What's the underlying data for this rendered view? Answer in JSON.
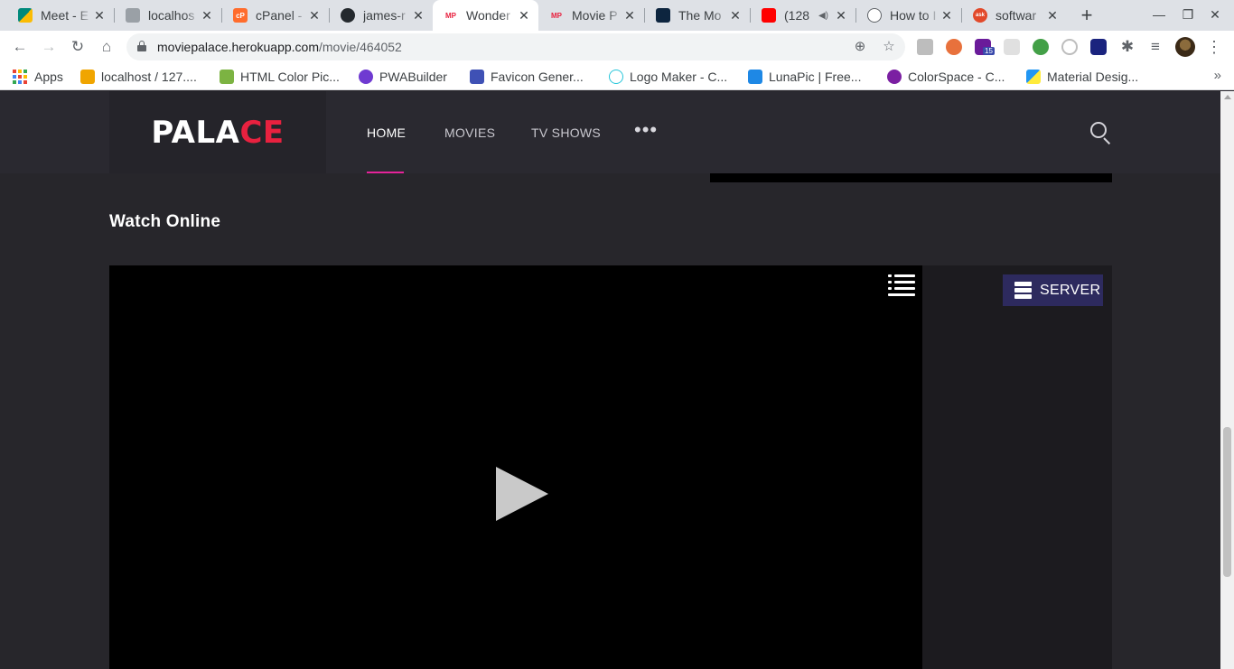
{
  "browser": {
    "tabs": [
      {
        "title": "Meet - E",
        "favicon_color": "#00897b",
        "favicon_text": ""
      },
      {
        "title": "localhos",
        "favicon_color": "#9aa0a6",
        "favicon_text": ""
      },
      {
        "title": "cPanel -",
        "favicon_color": "#ff6c2c",
        "favicon_text": "cP"
      },
      {
        "title": "james-r",
        "favicon_color": "#24292e",
        "favicon_text": ""
      },
      {
        "title": "Wonder",
        "favicon_color": "#ffffff",
        "favicon_text": "MP"
      },
      {
        "title": "Movie P",
        "favicon_color": "#ffffff",
        "favicon_text": "MP"
      },
      {
        "title": "The Mo",
        "favicon_color": "#0d253f",
        "favicon_text": ""
      },
      {
        "title": "(128",
        "favicon_color": "#ff0000",
        "favicon_text": ""
      },
      {
        "title": "How to I",
        "favicon_color": "#5f6368",
        "favicon_text": ""
      },
      {
        "title": "softwar",
        "favicon_color": "#e2492a",
        "favicon_text": "ask"
      }
    ],
    "url_host": "moviepalace.herokuapp.com",
    "url_path": "/movie/464052",
    "extension_badge": "15",
    "bookmarks": [
      {
        "label": "Apps"
      },
      {
        "label": "localhost / 127...."
      },
      {
        "label": "HTML Color Pic..."
      },
      {
        "label": "PWABuilder"
      },
      {
        "label": "Favicon Gener..."
      },
      {
        "label": "Logo Maker - C..."
      },
      {
        "label": "LunaPic | Free..."
      },
      {
        "label": "ColorSpace - C..."
      },
      {
        "label": "Material Desig..."
      }
    ]
  },
  "site": {
    "logo_main": "PALA",
    "logo_accent": "CE",
    "nav": {
      "home": "HOME",
      "movies": "MOVIES",
      "tv_shows": "TV SHOWS",
      "more": "•••"
    },
    "section_title": "Watch Online",
    "server_label": "SERVER"
  },
  "colors": {
    "accent_pink": "#e5239a",
    "logo_red": "#e8213f",
    "server_button": "#2d2a5e",
    "page_bg": "#27262b"
  }
}
